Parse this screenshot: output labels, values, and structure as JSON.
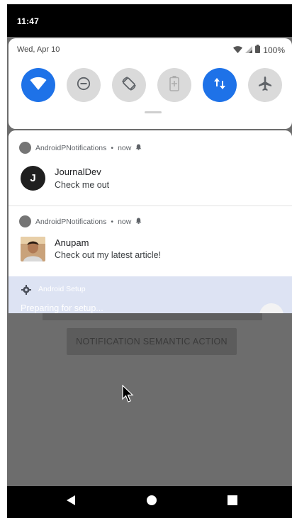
{
  "status_bar": {
    "time": "11:47"
  },
  "quick_settings": {
    "date": "Wed, Apr 10",
    "battery_percent": "100%",
    "tiles": [
      {
        "icon": "wifi-icon",
        "active": true
      },
      {
        "icon": "do-not-disturb-icon",
        "active": false
      },
      {
        "icon": "auto-rotate-icon",
        "active": false
      },
      {
        "icon": "battery-saver-icon",
        "active": false
      },
      {
        "icon": "mobile-data-icon",
        "active": true
      },
      {
        "icon": "airplane-mode-icon",
        "active": false
      }
    ],
    "accent_color": "#1e72e8"
  },
  "notifications": [
    {
      "app": "AndroidPNotifications",
      "time": "now",
      "avatar_letter": "J",
      "title": "JournalDev",
      "text": "Check me out"
    },
    {
      "app": "AndroidPNotifications",
      "time": "now",
      "title": "Anupam",
      "text": "Check out my latest article!"
    },
    {
      "app": "Android Setup",
      "text": "Preparing for setup..."
    }
  ],
  "background_app": {
    "button_label": "NOTIFICATION SEMANTIC ACTION"
  },
  "nav_bar": {
    "buttons": [
      "back-icon",
      "home-icon",
      "recents-icon"
    ]
  }
}
